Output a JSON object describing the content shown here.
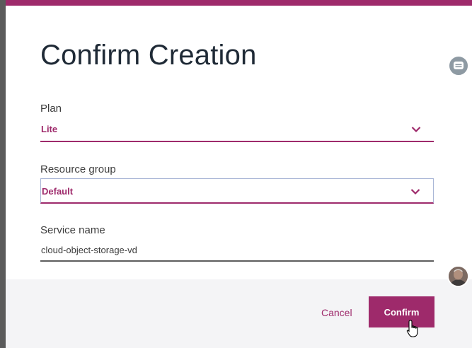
{
  "dialog": {
    "title": "Confirm Creation",
    "plan": {
      "label": "Plan",
      "value": "Lite"
    },
    "resource_group": {
      "label": "Resource group",
      "value": "Default"
    },
    "service_name": {
      "label": "Service name",
      "value": "cloud-object-storage-vd"
    },
    "cancel_label": "Cancel",
    "confirm_label": "Confirm"
  },
  "icons": {
    "select_chevron": "chevron-down-icon",
    "side_button": "chat-icon",
    "cursor": "hand-pointer-icon"
  },
  "colors": {
    "accent": "#9e2a6b",
    "title_text": "#1f2a36",
    "footer_bg": "#f4f4f6"
  }
}
